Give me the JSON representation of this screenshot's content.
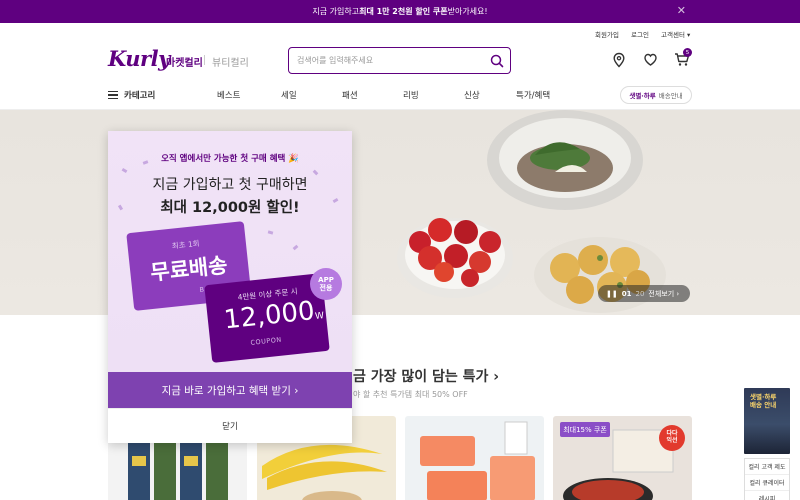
{
  "topbar": {
    "text_a": "지금 가입하고 ",
    "text_b": "최대 1만 2천원 할인 쿠폰",
    "text_c": " 받아가세요!"
  },
  "util": {
    "signup": "회원가입",
    "login": "로그인",
    "support": "고객센터 ▾"
  },
  "header": {
    "logo": "Kurly",
    "tab_market": "마켓컬리",
    "tab_beauty": "뷰티컬리",
    "search_placeholder": "검색어를 입력해주세요",
    "cart_count": "5"
  },
  "nav": {
    "category": "카테고리",
    "items": [
      "베스트",
      "세일",
      "패션",
      "리빙",
      "신상",
      "특가/혜택"
    ],
    "delivery_b": "샛별·하루",
    "delivery_s": "배송안내"
  },
  "hero": {
    "current": "01",
    "total": "20",
    "view_all": "전체보기 ›"
  },
  "section": {
    "title": "금 가장 많이 담는 특가",
    "subtitle": "야 할 추천 특가템 최대 50% OFF"
  },
  "cards": {
    "coupon_badge": "최대15% 쿠폰",
    "dada_badge": "다다\n익선"
  },
  "side": {
    "banner": "샛별·하루\n배송 안내",
    "links": [
      "컬리 고객 제도",
      "컬리 큐레이터",
      "레시피"
    ]
  },
  "popup": {
    "eyebrow": "오직 앱에서만 가능한 첫 구매 혜택 🎉",
    "title1": "지금 가입하고 첫 구매하면",
    "title2": "최대 12,000원 할인!",
    "ticket1_small": "최초 1회",
    "ticket1_big": "무료배송",
    "ticket1_label": "BENEFIT",
    "ticket2_small": "4만원 이상 주문 시",
    "ticket2_big": "12,000",
    "ticket2_unit": "W",
    "ticket2_label": "COUPON",
    "app_badge": "APP\n전용",
    "cta": "지금 바로 가입하고 혜택 받기  ›",
    "close": "닫기"
  },
  "colors": {
    "brand": "#5f0080",
    "popup_bg": "#f1e3f7",
    "cta": "#7e42b0"
  }
}
